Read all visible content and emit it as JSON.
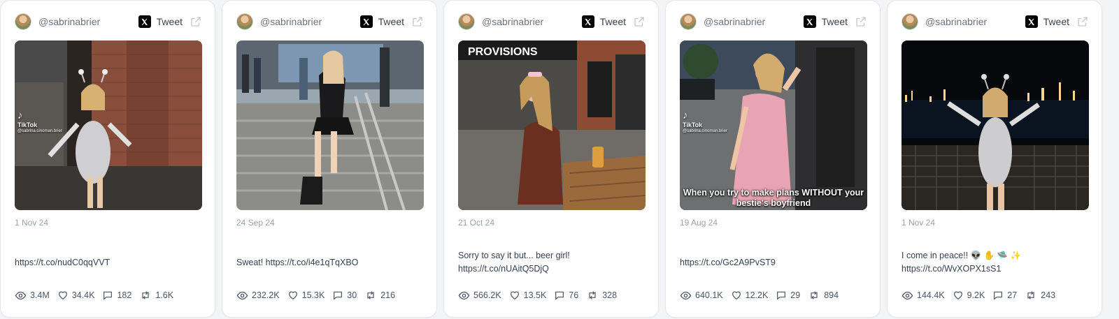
{
  "cards": [
    {
      "handle": "@sabrinabrier",
      "tweet_label": "Tweet",
      "date": "1 Nov 24",
      "text": "https://t.co/nudC0qqVVT",
      "media_caption": "",
      "tiktok_brand": "TikTok",
      "tiktok_user": "@sabrina.cinoman.brier",
      "stats": {
        "views": "3.4M",
        "likes": "34.4K",
        "replies": "182",
        "retweets": "1.6K"
      }
    },
    {
      "handle": "@sabrinabrier",
      "tweet_label": "Tweet",
      "date": "24 Sep 24",
      "text": "Sweat! https://t.co/i4e1qTqXBO",
      "media_caption": "",
      "stats": {
        "views": "232.2K",
        "likes": "15.3K",
        "replies": "30",
        "retweets": "216"
      }
    },
    {
      "handle": "@sabrinabrier",
      "tweet_label": "Tweet",
      "date": "21 Oct 24",
      "text": "Sorry to say it but... beer girl! https://t.co/nUAitQ5DjQ",
      "media_caption": "",
      "sign_text": "PROVISIONS",
      "stats": {
        "views": "566.2K",
        "likes": "13.5K",
        "replies": "76",
        "retweets": "328"
      }
    },
    {
      "handle": "@sabrinabrier",
      "tweet_label": "Tweet",
      "date": "19 Aug 24",
      "text": "https://t.co/Gc2A9PvST9",
      "media_caption": "When you try to make plans WITHOUT your bestie's boyfriend",
      "tiktok_brand": "TikTok",
      "tiktok_user": "@sabrina.cinoman.brier",
      "stats": {
        "views": "640.1K",
        "likes": "12.2K",
        "replies": "29",
        "retweets": "894"
      }
    },
    {
      "handle": "@sabrinabrier",
      "tweet_label": "Tweet",
      "date": "1 Nov 24",
      "text": "I come in peace!! 👽 ✋ 🛸 ✨ https://t.co/WvXOPX1sS1",
      "media_caption": "",
      "stats": {
        "views": "144.4K",
        "likes": "9.2K",
        "replies": "27",
        "retweets": "243"
      }
    }
  ],
  "icons": {
    "x_logo": "x-logo-icon",
    "external": "external-link-icon",
    "views": "eye-icon",
    "likes": "heart-icon",
    "replies": "comment-icon",
    "retweets": "retweet-icon"
  },
  "colors": {
    "card_bg": "#ffffff",
    "page_bg": "#f3f4f6",
    "muted": "#9ca3af",
    "text": "#374151"
  }
}
